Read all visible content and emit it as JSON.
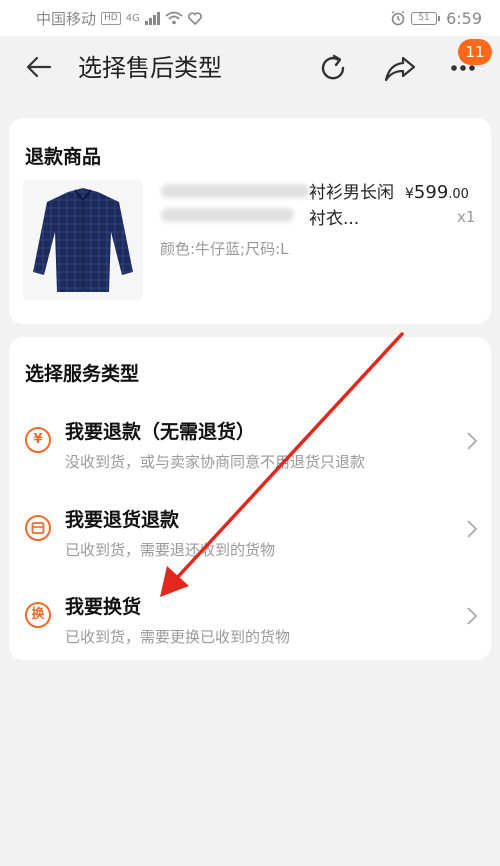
{
  "status_bar": {
    "carrier": "中国移动",
    "hd": "HD",
    "net": "4G",
    "battery": "51",
    "time": "6:59"
  },
  "nav": {
    "title": "选择售后类型",
    "badge": "11",
    "icons": [
      "back-arrow-icon",
      "refresh-icon",
      "share-icon",
      "more-icon"
    ]
  },
  "refund_goods": {
    "section_title": "退款商品",
    "product": {
      "name_visible": "衬衫男长闲衬衣...",
      "attributes": "颜色:牛仔蓝;尺码:L",
      "price_symbol": "¥",
      "price_int": "599",
      "price_dec": ".00",
      "quantity": "x1"
    }
  },
  "service_types": {
    "section_title": "选择服务类型",
    "options": [
      {
        "icon": "¥",
        "label": "我要退款（无需退货）",
        "desc": "没收到货，或与卖家协商同意不用退货只退款"
      },
      {
        "icon": "▭",
        "label": "我要退货退款",
        "desc": "已收到货，需要退还收到的货物"
      },
      {
        "icon": "换",
        "label": "我要换货",
        "desc": "已收到货，需要更换已收到的货物"
      }
    ]
  },
  "colors": {
    "accent": "#ef6a2a",
    "badge": "#ff6a1a",
    "annotation_arrow": "#e0281f",
    "background": "#f2f2f2"
  }
}
